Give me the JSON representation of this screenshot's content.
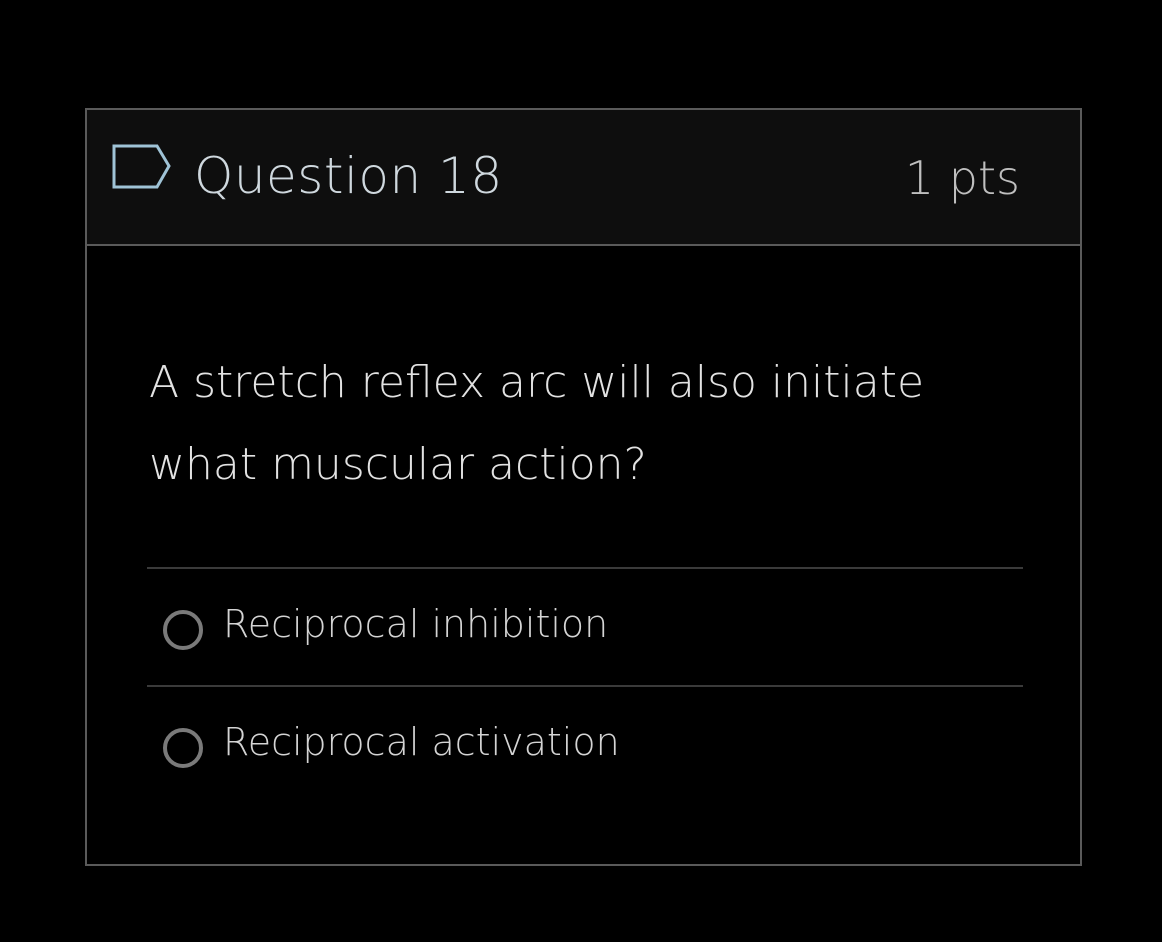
{
  "question": {
    "title": "Question 18",
    "points": "1 pts",
    "flag_icon": "flag-outline-icon",
    "prompt": "A stretch reflex arc will also initiate what muscular action?"
  },
  "answers": [
    {
      "label": "Reciprocal inhibition",
      "selected": false
    },
    {
      "label": "Reciprocal activation",
      "selected": false
    }
  ],
  "colors": {
    "background": "#000000",
    "header_background": "#0e0e0e",
    "border": "#5a5a5a",
    "title_text": "#cfd8de",
    "flag_stroke": "#9fc3d6"
  }
}
